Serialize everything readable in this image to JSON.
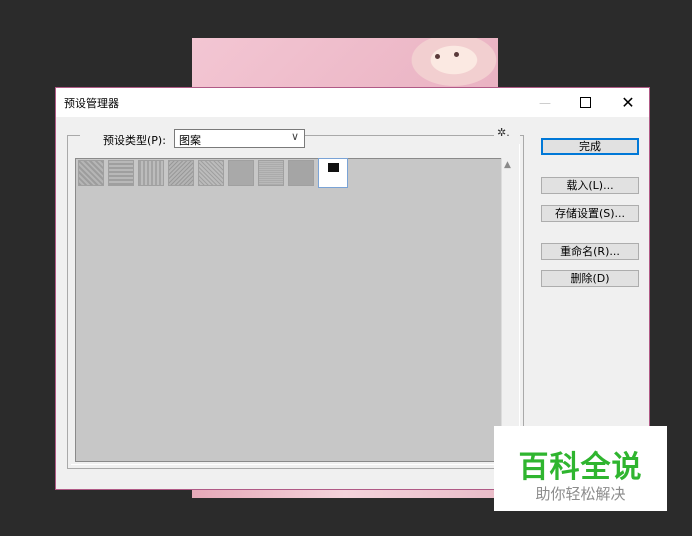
{
  "dialog": {
    "title": "预设管理器",
    "window_controls": {
      "minimize_icon": "minimize-icon",
      "maximize_icon": "maximize-icon",
      "close_glyph": "✕"
    }
  },
  "preset_type": {
    "label": "预设类型(P):",
    "selected": "图案",
    "dropdown_arrow": "∨"
  },
  "settings_menu_glyph": "✲.",
  "preset_list": {
    "swatches": [
      "pattern-1",
      "pattern-2",
      "pattern-3",
      "pattern-4",
      "pattern-5",
      "pattern-6",
      "pattern-7",
      "pattern-8",
      "pattern-9-selected"
    ],
    "scroll_up_glyph": "▲"
  },
  "buttons": {
    "done": "完成",
    "load": "载入(L)...",
    "save": "存储设置(S)...",
    "rename": "重命名(R)...",
    "delete": "删除(D)"
  },
  "watermark": {
    "title": "百科全说",
    "subtitle": "助你轻松解决"
  },
  "colors": {
    "background": "#2b2b2b",
    "window_border": "#b05a86",
    "default_button_border": "#0078d7",
    "watermark_green": "#2fb52f"
  }
}
